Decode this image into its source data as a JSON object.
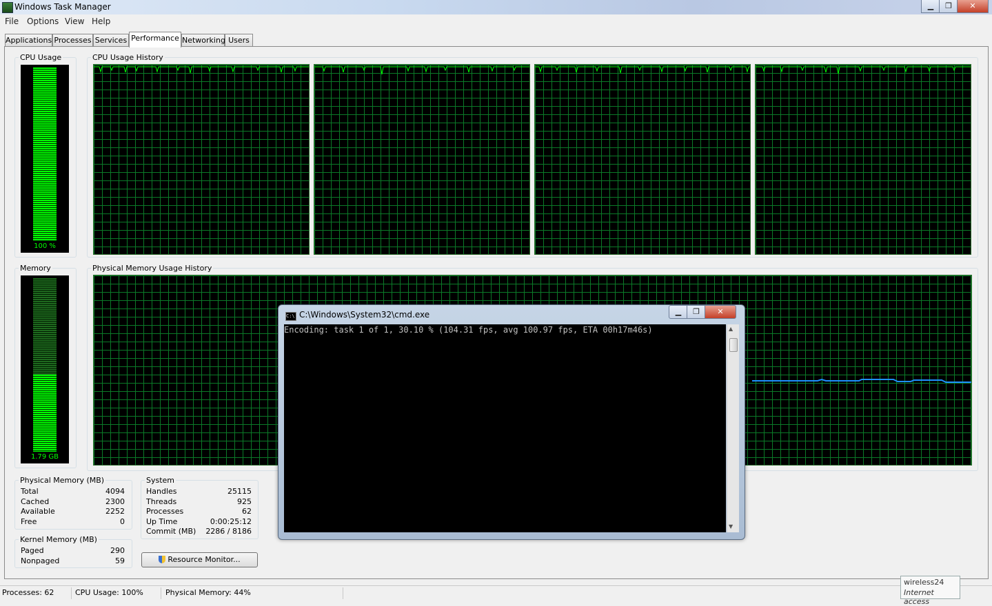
{
  "window": {
    "title": "Windows Task Manager"
  },
  "menu": [
    "File",
    "Options",
    "View",
    "Help"
  ],
  "tabs": [
    "Applications",
    "Processes",
    "Services",
    "Performance",
    "Networking",
    "Users"
  ],
  "active_tab": "Performance",
  "cpu": {
    "label": "CPU Usage",
    "value_text": "100 %",
    "level": 1.0,
    "history_label": "CPU Usage History"
  },
  "memory": {
    "label": "Memory",
    "value_text": "1.79 GB",
    "level": 0.44,
    "history_label": "Physical Memory Usage History"
  },
  "physical_memory": {
    "title": "Physical Memory (MB)",
    "rows": [
      {
        "label": "Total",
        "value": "4094"
      },
      {
        "label": "Cached",
        "value": "2300"
      },
      {
        "label": "Available",
        "value": "2252"
      },
      {
        "label": "Free",
        "value": "0"
      }
    ]
  },
  "kernel_memory": {
    "title": "Kernel Memory (MB)",
    "rows": [
      {
        "label": "Paged",
        "value": "290"
      },
      {
        "label": "Nonpaged",
        "value": "59"
      }
    ]
  },
  "system": {
    "title": "System",
    "rows": [
      {
        "label": "Handles",
        "value": "25115"
      },
      {
        "label": "Threads",
        "value": "925"
      },
      {
        "label": "Processes",
        "value": "62"
      },
      {
        "label": "Up Time",
        "value": "0:00:25:12"
      },
      {
        "label": "Commit (MB)",
        "value": "2286 / 8186"
      }
    ]
  },
  "resource_monitor_button": "Resource Monitor...",
  "status": {
    "processes": "Processes: 62",
    "cpu": "CPU Usage: 100%",
    "memory": "Physical Memory: 44%"
  },
  "cmd": {
    "title": "C:\\Windows\\System32\\cmd.exe",
    "output": "Encoding: task 1 of 1, 30.10 % (104.31 fps, avg 100.97 fps, ETA 00h17m46s)"
  },
  "tooltip": {
    "line1": "wireless24",
    "line2": "Internet access"
  },
  "colors": {
    "graph_line": "#00ff00",
    "grid": "#0b7a28",
    "memory_line": "#1e90ff"
  }
}
